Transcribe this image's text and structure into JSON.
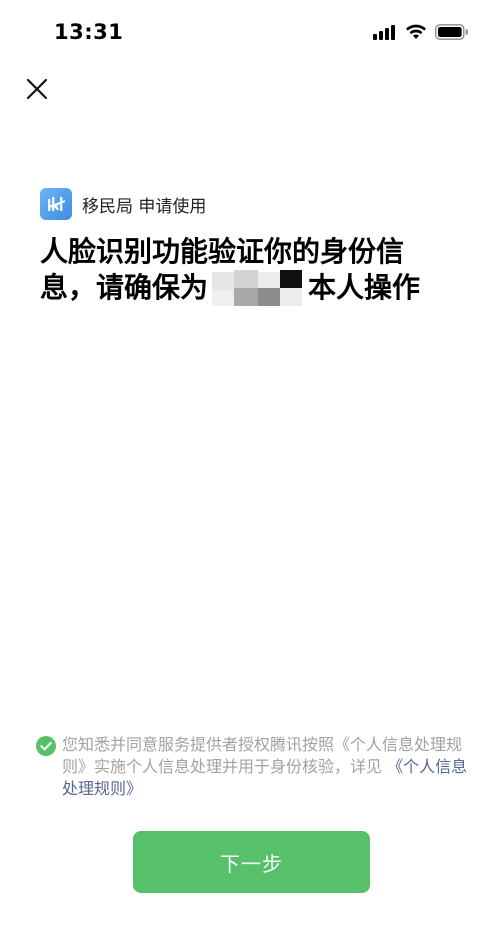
{
  "status_bar": {
    "time": "13:31",
    "icons": [
      "cellular-signal-icon",
      "wifi-icon",
      "battery-icon"
    ]
  },
  "header": {
    "close_icon": "close-icon"
  },
  "requester": {
    "logo_icon": "app-logo-icon",
    "label": "移民局 申请使用"
  },
  "heading": {
    "line1": "人脸识别功能验证你的身份信",
    "line2_prefix": "息，请确保为",
    "line2_suffix": "本人操作"
  },
  "consent": {
    "checked": true,
    "text_before_link1": "您知悉并同意服务提供者授权腾讯按照",
    "link1": "《个人信息处理规则》",
    "text_middle": "实施个人信息处理并用于身份核验，详见",
    "link2": "《个人信息处理规则》"
  },
  "actions": {
    "next_label": "下一步"
  },
  "colors": {
    "primary_green": "#56c06a",
    "link_blue": "#56688f",
    "muted_text": "#a2a2a2",
    "logo_blue": "#4a97e6"
  }
}
